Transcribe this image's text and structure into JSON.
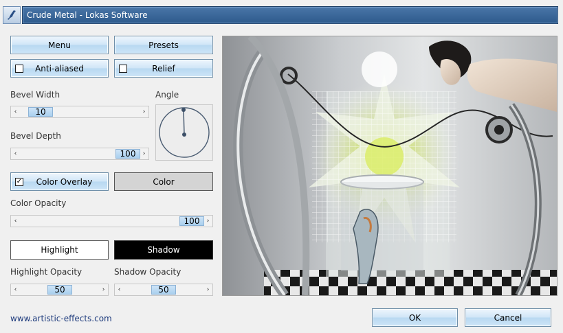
{
  "window": {
    "title": "Crude Metal - Lokas Software",
    "icon": "brush-icon"
  },
  "buttons": {
    "menu": "Menu",
    "presets": "Presets",
    "anti_aliased": "Anti-aliased",
    "relief": "Relief",
    "color_overlay": "Color Overlay",
    "color": "Color",
    "highlight": "Highlight",
    "shadow": "Shadow",
    "ok": "OK",
    "cancel": "Cancel"
  },
  "checkboxes": {
    "anti_aliased_checked": false,
    "relief_checked": false,
    "color_overlay_checked": true,
    "check_mark": "✓"
  },
  "labels": {
    "bevel_width": "Bevel Width",
    "bevel_depth": "Bevel Depth",
    "angle": "Angle",
    "color_opacity": "Color Opacity",
    "highlight_opacity": "Highlight Opacity",
    "shadow_opacity": "Shadow Opacity"
  },
  "values": {
    "bevel_width": "10",
    "bevel_depth": "100",
    "color_opacity": "100",
    "highlight_opacity": "50",
    "shadow_opacity": "50"
  },
  "arrows": {
    "left": "‹",
    "right": "›"
  },
  "footer": {
    "link": "www.artistic-effects.com"
  },
  "colors": {
    "title_bar": "#2d5a8c",
    "highlight_swatch": "#ffffff",
    "shadow_swatch": "#000000",
    "color_swatch": "#d4d4d4",
    "link": "#1d3a7c"
  }
}
